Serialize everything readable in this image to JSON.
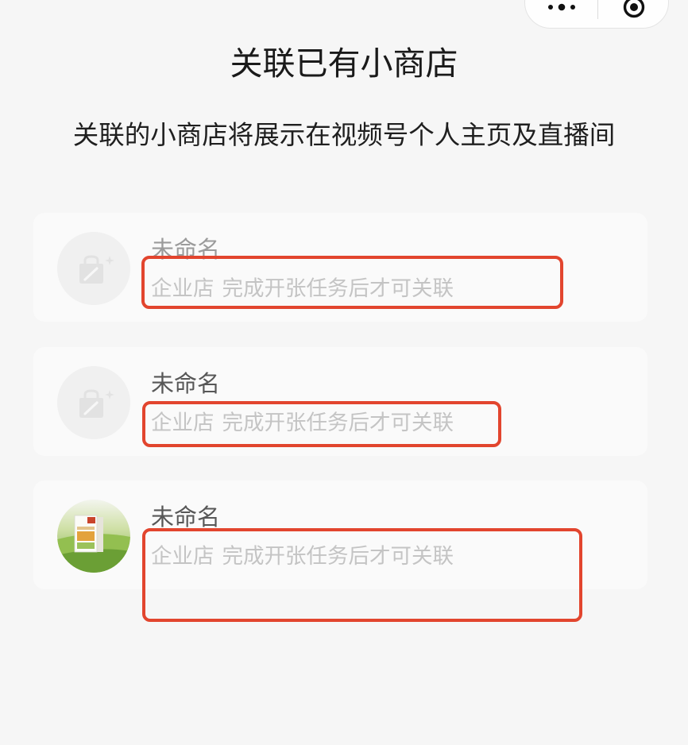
{
  "capsule": {
    "more_icon": "more-dots-icon",
    "exit_icon": "target-icon"
  },
  "header": {
    "title": "关联已有小商店",
    "subtitle": "关联的小商店将展示在视频号个人主页及直播间"
  },
  "shops": [
    {
      "name": "未命名",
      "type": "企业店",
      "status": "完成开张任务后才可关联",
      "avatar_icon": "shop-bag-icon"
    },
    {
      "name": "未命名",
      "type": "企业店",
      "status": "完成开张任务后才可关联",
      "avatar_icon": "shop-bag-icon"
    },
    {
      "name": "未命名",
      "type": "企业店",
      "status": "完成开张任务后才可关联",
      "avatar_icon": "shop-thumbnail-image"
    }
  ],
  "colors": {
    "page_background": "#f6f6f6",
    "card_background": "#fafafa",
    "avatar_background": "#f0f0f0",
    "title_text": "#1a1a1a",
    "name_text": "#575757",
    "muted_text": "#c4c4c4",
    "annotation_red": "#e2452e"
  }
}
